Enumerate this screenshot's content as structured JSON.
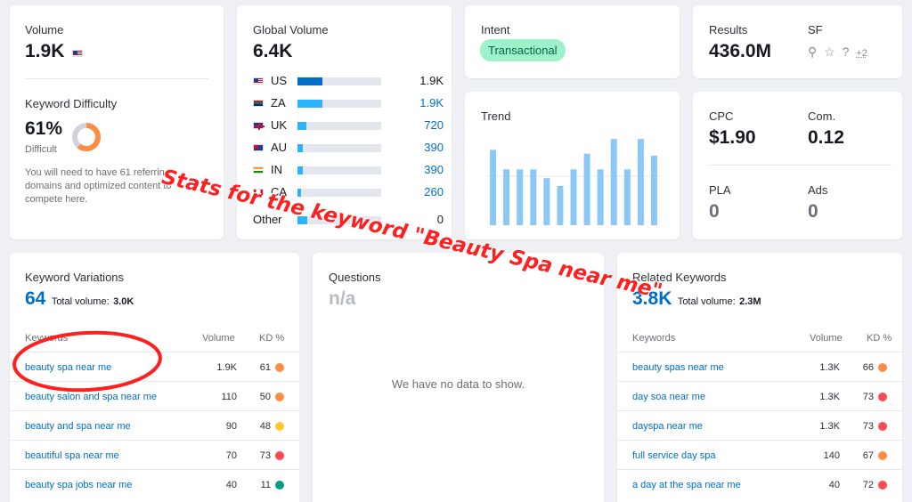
{
  "volume": {
    "label": "Volume",
    "value": "1.9K"
  },
  "kd": {
    "label": "Keyword Difficulty",
    "value": "61%",
    "level": "Difficult",
    "percent": 61,
    "description": "You will need to have 61 referring domains and optimized content to compete here."
  },
  "global_volume": {
    "label": "Global Volume",
    "value": "6.4K",
    "countries": [
      {
        "code": "US",
        "value": "1.9K",
        "share": 0.3
      },
      {
        "code": "ZA",
        "value": "1.9K",
        "share": 0.3
      },
      {
        "code": "UK",
        "value": "720",
        "share": 0.11
      },
      {
        "code": "AU",
        "value": "390",
        "share": 0.06
      },
      {
        "code": "IN",
        "value": "390",
        "share": 0.06
      },
      {
        "code": "CA",
        "value": "260",
        "share": 0.04
      }
    ],
    "other": {
      "label": "Other",
      "value": "0",
      "share": 0.12
    }
  },
  "intent": {
    "label": "Intent",
    "value": "Transactional"
  },
  "results": {
    "label": "Results",
    "value": "436.0M"
  },
  "sf": {
    "label": "SF",
    "more": "+2"
  },
  "trend": {
    "label": "Trend",
    "values": [
      0.77,
      0.57,
      0.57,
      0.57,
      0.48,
      0.4,
      0.57,
      0.73,
      0.57,
      0.88,
      0.57,
      0.88,
      0.71
    ]
  },
  "cpc": {
    "label": "CPC",
    "value": "$1.90"
  },
  "com": {
    "label": "Com.",
    "value": "0.12"
  },
  "pla": {
    "label": "PLA",
    "value": "0"
  },
  "ads": {
    "label": "Ads",
    "value": "0"
  },
  "variations": {
    "label": "Keyword Variations",
    "count": "64",
    "total_label": "Total volume:",
    "total_value": "3.0K",
    "col_keywords": "Keywords",
    "col_volume": "Volume",
    "col_kd": "KD %",
    "rows": [
      {
        "keyword": "beauty spa near me",
        "volume": "1.9K",
        "kd": "61",
        "color": "#ff8c43"
      },
      {
        "keyword": "beauty salon and spa near me",
        "volume": "110",
        "kd": "50",
        "color": "#ff8c43"
      },
      {
        "keyword": "beauty and spa near me",
        "volume": "90",
        "kd": "48",
        "color": "#ffc82c"
      },
      {
        "keyword": "beautiful spa near me",
        "volume": "70",
        "kd": "73",
        "color": "#ff4953"
      },
      {
        "keyword": "beauty spa jobs near me",
        "volume": "40",
        "kd": "11",
        "color": "#009f81"
      }
    ]
  },
  "questions": {
    "label": "Questions",
    "value": "n/a",
    "empty": "We have no data to show."
  },
  "related": {
    "label": "Related Keywords",
    "count": "3.8K",
    "total_label": "Total volume:",
    "total_value": "2.3M",
    "col_keywords": "Keywords",
    "col_volume": "Volume",
    "col_kd": "KD %",
    "rows": [
      {
        "keyword": "beauty spas near me",
        "volume": "1.3K",
        "kd": "66",
        "color": "#ff8c43"
      },
      {
        "keyword": "day soa near me",
        "volume": "1.3K",
        "kd": "73",
        "color": "#ff4953"
      },
      {
        "keyword": "dayspa near me",
        "volume": "1.3K",
        "kd": "73",
        "color": "#ff4953"
      },
      {
        "keyword": "full service day spa",
        "volume": "140",
        "kd": "67",
        "color": "#ff8c43"
      },
      {
        "keyword": "a day at the spa near me",
        "volume": "40",
        "kd": "72",
        "color": "#ff4953"
      }
    ]
  },
  "annotation": "Stats for the keyword \"Beauty Spa near me\""
}
